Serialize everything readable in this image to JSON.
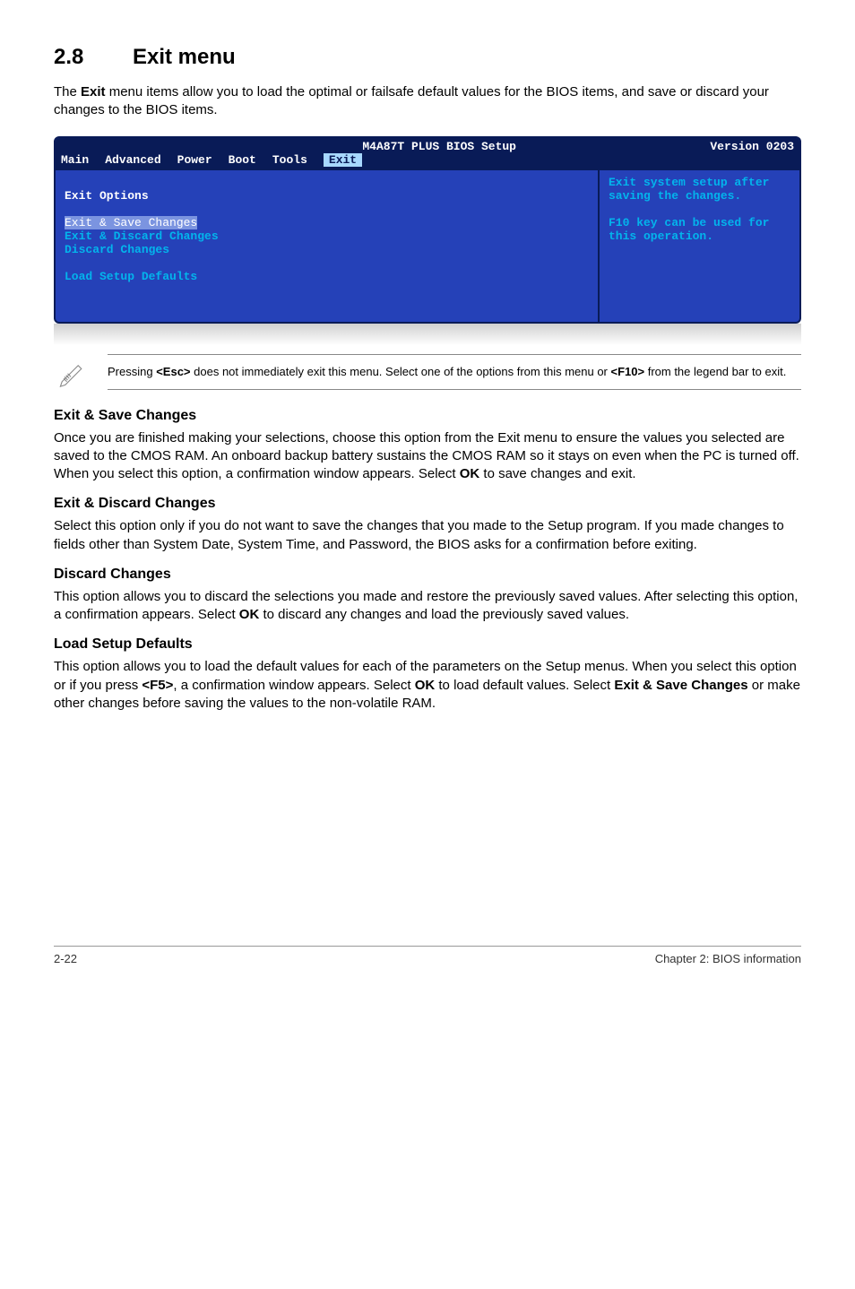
{
  "section": {
    "number": "2.8",
    "title": "Exit menu"
  },
  "intro_before": "The ",
  "intro_bold1": "Exit",
  "intro_after": " menu items allow you to load the optimal or failsafe default values for the BIOS items, and save or discard your changes to the BIOS items.",
  "bios": {
    "title_mid": "M4A87T PLUS BIOS Setup",
    "version": "Version 0203",
    "menu": {
      "main": "Main",
      "advanced": "Advanced",
      "power": "Power",
      "boot": "Boot",
      "tools": "Tools",
      "exit": "Exit"
    },
    "left": {
      "header": "Exit Options",
      "item1": "Exit & Save Changes",
      "item2": "Exit & Discard Changes",
      "item3": "Discard Changes",
      "item4": "Load Setup Defaults"
    },
    "right": "Exit system setup after saving the changes.\n\nF10 key can be used for this operation."
  },
  "note_before": "Pressing ",
  "note_esc": "<Esc>",
  "note_mid": " does not immediately exit this menu. Select one of the options from this menu or ",
  "note_f10": "<F10>",
  "note_after": " from the legend bar to exit.",
  "sections": {
    "s1": {
      "h": "Exit & Save Changes",
      "p_before": "Once you are finished making your selections, choose this option from the Exit menu to ensure the values you selected are saved to the CMOS RAM. An onboard backup battery sustains the CMOS RAM so it stays on even when the PC is turned off. When you select this option, a confirmation window appears. Select ",
      "p_bold": "OK",
      "p_after": " to save changes and exit."
    },
    "s2": {
      "h": "Exit & Discard Changes",
      "p": "Select this option only if you do not want to save the changes that you made to the Setup program. If you made changes to fields other than System Date, System Time, and Password, the BIOS asks for a confirmation before exiting."
    },
    "s3": {
      "h": "Discard Changes",
      "p_before": "This option allows you to discard the selections you made and restore the previously saved values. After selecting this option, a confirmation appears. Select ",
      "p_bold": "OK",
      "p_after": " to discard any changes and load the previously saved values."
    },
    "s4": {
      "h": "Load Setup Defaults",
      "p_before": "This option allows you to load the default values for each of the parameters on the Setup menus. When you select this option or if you press ",
      "p_f5": "<F5>",
      "p_mid1": ", a confirmation window appears. Select ",
      "p_ok": "OK",
      "p_mid2": " to load default values. Select ",
      "p_esc": "Exit & Save Changes",
      "p_after": " or make other changes before saving the values to the non-volatile RAM."
    }
  },
  "footer": {
    "left": "2-22",
    "right": "Chapter 2: BIOS information"
  }
}
